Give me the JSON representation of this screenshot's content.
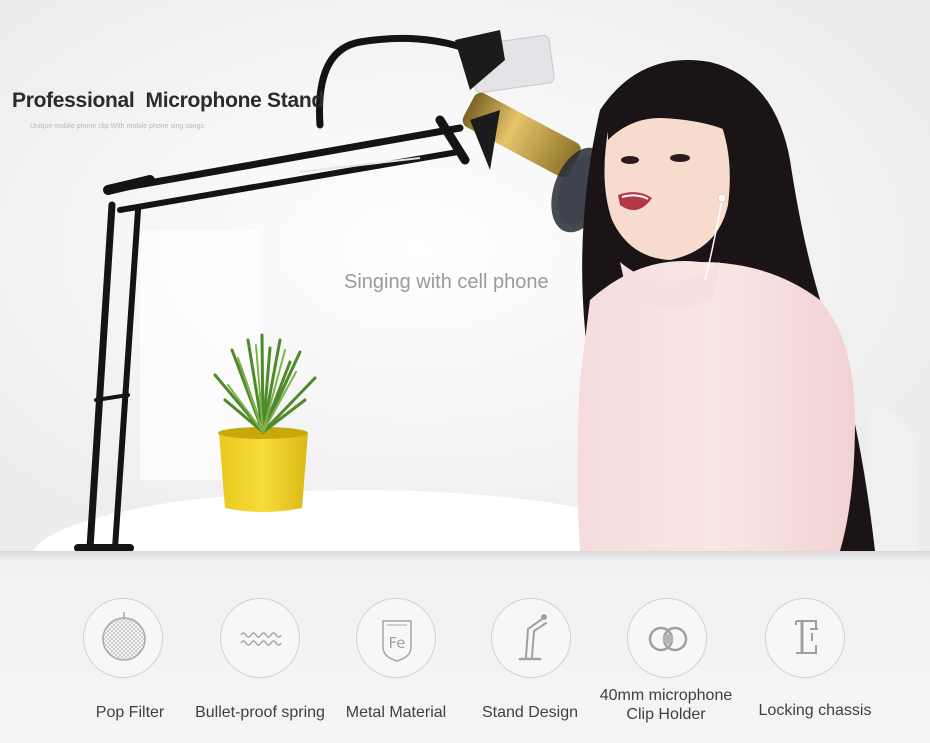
{
  "banner": {
    "title": "Professional  Microphone Stand",
    "subtitle": "Unique mobile phone clip With mobile phone sing songs",
    "caption": "Singing with cell phone"
  },
  "features": [
    {
      "icon": "pop-filter-icon",
      "label": "Pop Filter"
    },
    {
      "icon": "spring-icon",
      "label": "Bullet-proof spring"
    },
    {
      "icon": "fe-shield-icon",
      "label": "Metal Material"
    },
    {
      "icon": "stand-arm-icon",
      "label": "Stand Design"
    },
    {
      "icon": "clip-holder-icon",
      "label_line1": "40mm microphone",
      "label_line2": "Clip Holder"
    },
    {
      "icon": "clamp-icon",
      "label": "Locking chassis"
    }
  ]
}
